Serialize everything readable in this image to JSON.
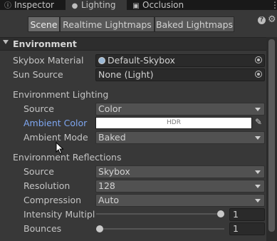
{
  "tabs": [
    {
      "label": "Inspector",
      "icon": "info-icon"
    },
    {
      "label": "Lighting",
      "icon": "bulb-icon"
    },
    {
      "label": "Occlusion",
      "icon": "occlusion-icon"
    }
  ],
  "subtabs": [
    "Scene",
    "Realtime Lightmaps",
    "Baked Lightmaps"
  ],
  "environment": {
    "header": "Environment",
    "skybox_material_label": "Skybox Material",
    "skybox_material_value": "Default-Skybox",
    "sun_source_label": "Sun Source",
    "sun_source_value": "None (Light)"
  },
  "env_lighting": {
    "title": "Environment Lighting",
    "source_label": "Source",
    "source_value": "Color",
    "ambient_color_label": "Ambient Color",
    "ambient_color_hdr": "HDR",
    "ambient_color": "#ffffff",
    "ambient_mode_label": "Ambient Mode",
    "ambient_mode_value": "Baked"
  },
  "env_reflections": {
    "title": "Environment Reflections",
    "source_label": "Source",
    "source_value": "Skybox",
    "resolution_label": "Resolution",
    "resolution_value": "128",
    "compression_label": "Compression",
    "compression_value": "Auto",
    "intensity_label": "Intensity Multiplie",
    "intensity_value": "1",
    "intensity_fraction": 1.0,
    "bounces_label": "Bounces",
    "bounces_value": "1",
    "bounces_fraction": 0.0
  }
}
